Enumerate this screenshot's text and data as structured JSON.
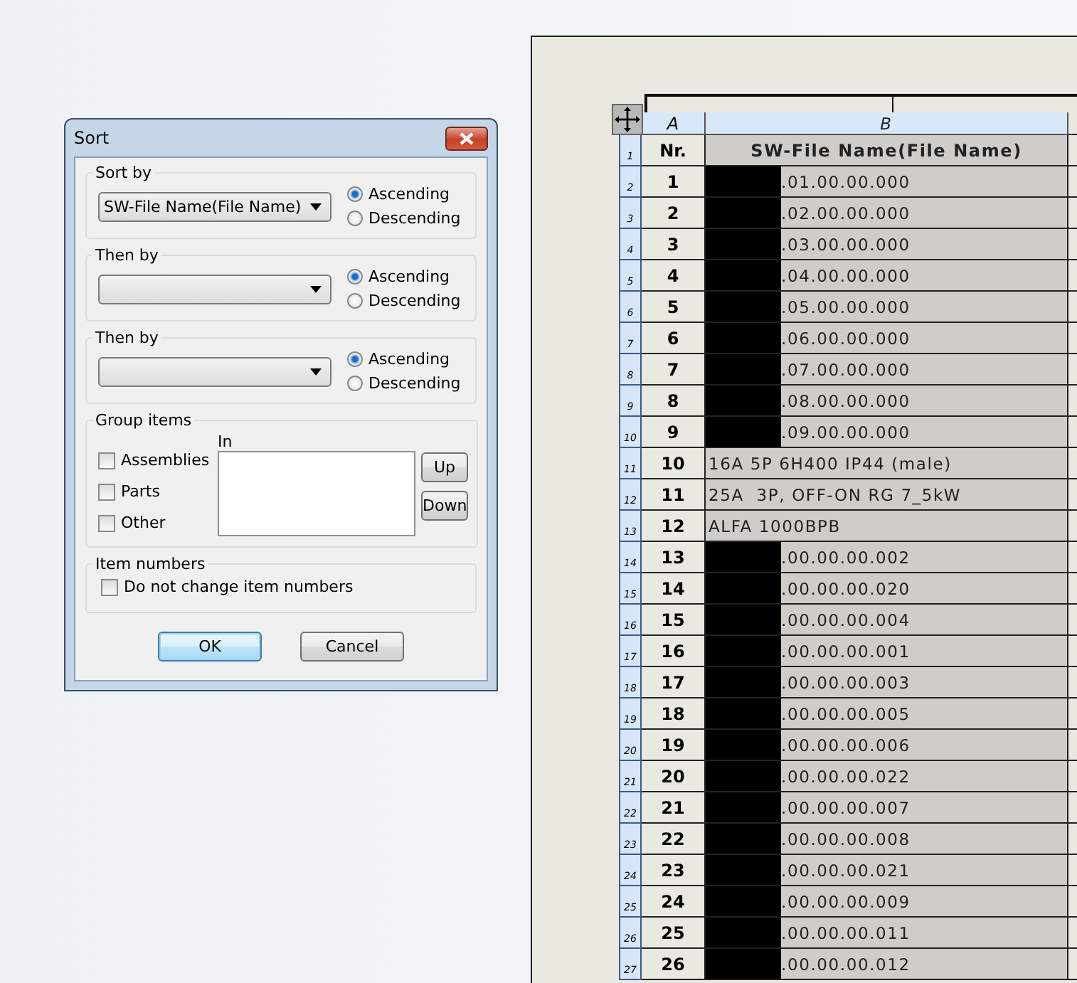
{
  "dialog": {
    "title": "Sort",
    "sort_levels": [
      {
        "label": "Sort by",
        "value": "SW-File Name(File Name)",
        "options": [
          {
            "label": "Ascending",
            "selected": true
          },
          {
            "label": "Descending",
            "selected": false
          }
        ]
      },
      {
        "label": "Then by",
        "options": [
          {
            "label": "Ascending",
            "selected": true
          },
          {
            "label": "Descending",
            "selected": false
          }
        ]
      },
      {
        "label": "Then by",
        "options": [
          {
            "label": "Ascending",
            "selected": true
          },
          {
            "label": "Descending",
            "selected": false
          }
        ]
      }
    ],
    "group_items": {
      "label": "Group items",
      "in_label": "In",
      "checkboxes": [
        {
          "label": "Assemblies",
          "checked": false
        },
        {
          "label": "Parts",
          "checked": false
        },
        {
          "label": "Other",
          "checked": false
        }
      ],
      "buttons": [
        "Up",
        "Down"
      ]
    },
    "item_numbers": {
      "label": "Item numbers",
      "checkbox": {
        "label": "Do not change item numbers",
        "checked": false
      }
    },
    "buttons": [
      {
        "label": "OK",
        "default": true
      },
      {
        "label": "Cancel",
        "default": false
      }
    ]
  },
  "table": {
    "columns": [
      "A",
      "B"
    ],
    "header": {
      "row_number": "1",
      "nr": "Nr.",
      "name": "SW-File Name(File Name)"
    },
    "rows": [
      {
        "row_number": "2",
        "nr": "1",
        "name": ".01.00.00.000",
        "redacted": true
      },
      {
        "row_number": "3",
        "nr": "2",
        "name": ".02.00.00.000",
        "redacted": true
      },
      {
        "row_number": "4",
        "nr": "3",
        "name": ".03.00.00.000",
        "redacted": true
      },
      {
        "row_number": "5",
        "nr": "4",
        "name": ".04.00.00.000",
        "redacted": true
      },
      {
        "row_number": "6",
        "nr": "5",
        "name": ".05.00.00.000",
        "redacted": true
      },
      {
        "row_number": "7",
        "nr": "6",
        "name": ".06.00.00.000",
        "redacted": true
      },
      {
        "row_number": "8",
        "nr": "7",
        "name": ".07.00.00.000",
        "redacted": true
      },
      {
        "row_number": "9",
        "nr": "8",
        "name": ".08.00.00.000",
        "redacted": true
      },
      {
        "row_number": "10",
        "nr": "9",
        "name": ".09.00.00.000",
        "redacted": true
      },
      {
        "row_number": "11",
        "nr": "10",
        "name": "16A 5P 6H400 IP44 (male)",
        "redacted": false
      },
      {
        "row_number": "12",
        "nr": "11",
        "name": "25A  3P, OFF-ON RG 7_5kW",
        "redacted": false
      },
      {
        "row_number": "13",
        "nr": "12",
        "name": "ALFA 1000BPB",
        "redacted": false
      },
      {
        "row_number": "14",
        "nr": "13",
        "name": ".00.00.00.002",
        "redacted": true
      },
      {
        "row_number": "15",
        "nr": "14",
        "name": ".00.00.00.020",
        "redacted": true
      },
      {
        "row_number": "16",
        "nr": "15",
        "name": ".00.00.00.004",
        "redacted": true
      },
      {
        "row_number": "17",
        "nr": "16",
        "name": ".00.00.00.001",
        "redacted": true
      },
      {
        "row_number": "18",
        "nr": "17",
        "name": ".00.00.00.003",
        "redacted": true
      },
      {
        "row_number": "19",
        "nr": "18",
        "name": ".00.00.00.005",
        "redacted": true
      },
      {
        "row_number": "20",
        "nr": "19",
        "name": ".00.00.00.006",
        "redacted": true
      },
      {
        "row_number": "21",
        "nr": "20",
        "name": ".00.00.00.022",
        "redacted": true
      },
      {
        "row_number": "22",
        "nr": "21",
        "name": ".00.00.00.007",
        "redacted": true
      },
      {
        "row_number": "23",
        "nr": "22",
        "name": ".00.00.00.008",
        "redacted": true
      },
      {
        "row_number": "24",
        "nr": "23",
        "name": ".00.00.00.021",
        "redacted": true
      },
      {
        "row_number": "25",
        "nr": "24",
        "name": ".00.00.00.009",
        "redacted": true
      },
      {
        "row_number": "26",
        "nr": "25",
        "name": ".00.00.00.011",
        "redacted": true
      },
      {
        "row_number": "27",
        "nr": "26",
        "name": ".00.00.00.012",
        "redacted": true
      }
    ]
  }
}
